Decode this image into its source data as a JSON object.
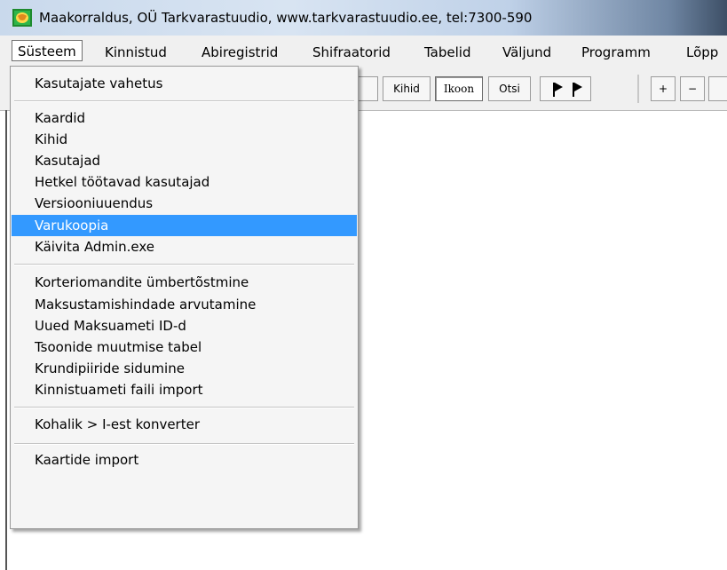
{
  "window": {
    "title": "Maakorraldus, OÜ Tarkvarastuudio, www.tarkvarastuudio.ee, tel:7300-590",
    "icon": "app-globe-icon"
  },
  "menubar": {
    "items": [
      {
        "label": "Süsteem",
        "active": true
      },
      {
        "label": "Kinnistud"
      },
      {
        "label": "Abiregistrid"
      },
      {
        "label": "Shifraatorid"
      },
      {
        "label": "Tabelid"
      },
      {
        "label": "Väljund"
      },
      {
        "label": "Programm"
      },
      {
        "label": "Lõpp"
      }
    ]
  },
  "toolbar": {
    "kihid": "Kihid",
    "ikoon": "Ikoon",
    "otsi": "Otsi",
    "plus": "+",
    "minus": "−",
    "flags_icon": "flag-icon"
  },
  "dropdown": {
    "groups": [
      [
        "Kasutajate vahetus"
      ],
      [
        "Kaardid",
        "Kihid",
        "Kasutajad",
        "Hetkel töötavad kasutajad",
        "Versiooniuuendus",
        "Varukoopia",
        "Käivita Admin.exe"
      ],
      [
        "Korteriomandite ümbertõstmine",
        "Maksustamishindade arvutamine",
        "Uued Maksuameti ID-d",
        "Tsoonide muutmise tabel",
        "Krundipiiride sidumine",
        "Kinnistuameti faili import"
      ],
      [
        "Kohalik > I-est konverter"
      ],
      [
        "Kaartide import"
      ]
    ],
    "selected": "Varukoopia",
    "highlight_color": "#3399ff"
  }
}
